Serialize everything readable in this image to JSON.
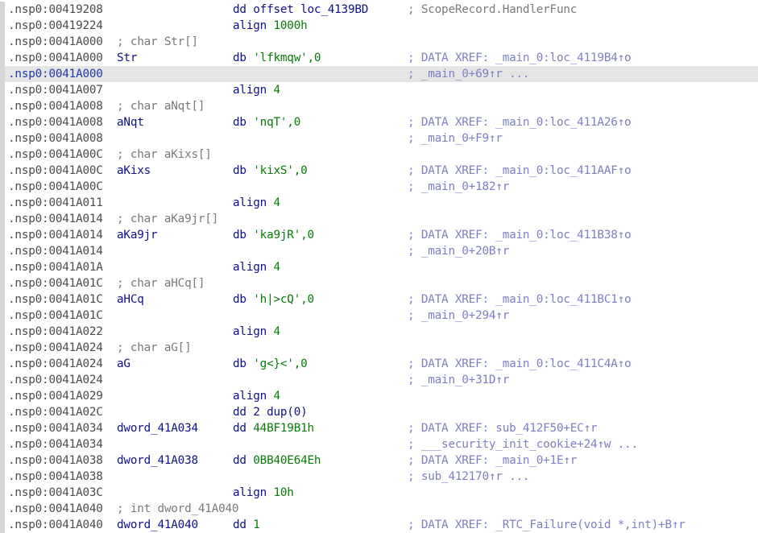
{
  "listing": {
    "lines": [
      {
        "addr": ".nsp0:00419208",
        "label": "",
        "mnemonic": "dd",
        "operand": "offset loc_4139BD",
        "operand_kind": "plain",
        "comment": "; ScopeRecord.HandlerFunc",
        "comment_kind": "gray",
        "header": ""
      },
      {
        "addr": ".nsp0:00419224",
        "label": "",
        "mnemonic": "align",
        "operand": "1000h",
        "operand_kind": "num",
        "comment": "",
        "comment_kind": "",
        "header": ""
      },
      {
        "addr": ".nsp0:0041A000",
        "label": "",
        "mnemonic": "",
        "operand": "",
        "operand_kind": "",
        "comment": "",
        "comment_kind": "",
        "header": "; char Str[]"
      },
      {
        "addr": ".nsp0:0041A000",
        "label": "Str",
        "mnemonic": "db",
        "operand": "'lfkmqw',0",
        "operand_kind": "str",
        "comment": "; DATA XREF: _main_0:loc_4119B4↑o",
        "comment_kind": "xref",
        "header": ""
      },
      {
        "addr": ".nsp0:0041A000",
        "label": "",
        "mnemonic": "",
        "operand": "",
        "operand_kind": "",
        "comment": "; _main_0+69↑r ...",
        "comment_kind": "xref",
        "header": "",
        "selected": true
      },
      {
        "addr": ".nsp0:0041A007",
        "label": "",
        "mnemonic": "align",
        "operand": "4",
        "operand_kind": "num",
        "comment": "",
        "comment_kind": "",
        "header": ""
      },
      {
        "addr": ".nsp0:0041A008",
        "label": "",
        "mnemonic": "",
        "operand": "",
        "operand_kind": "",
        "comment": "",
        "comment_kind": "",
        "header": "; char aNqt[]"
      },
      {
        "addr": ".nsp0:0041A008",
        "label": "aNqt",
        "mnemonic": "db",
        "operand": "'nqT',0",
        "operand_kind": "str",
        "comment": "; DATA XREF: _main_0:loc_411A26↑o",
        "comment_kind": "xref",
        "header": ""
      },
      {
        "addr": ".nsp0:0041A008",
        "label": "",
        "mnemonic": "",
        "operand": "",
        "operand_kind": "",
        "comment": "; _main_0+F9↑r",
        "comment_kind": "xref",
        "header": ""
      },
      {
        "addr": ".nsp0:0041A00C",
        "label": "",
        "mnemonic": "",
        "operand": "",
        "operand_kind": "",
        "comment": "",
        "comment_kind": "",
        "header": "; char aKixs[]"
      },
      {
        "addr": ".nsp0:0041A00C",
        "label": "aKixs",
        "mnemonic": "db",
        "operand": "'kixS',0",
        "operand_kind": "str",
        "comment": "; DATA XREF: _main_0:loc_411AAF↑o",
        "comment_kind": "xref",
        "header": ""
      },
      {
        "addr": ".nsp0:0041A00C",
        "label": "",
        "mnemonic": "",
        "operand": "",
        "operand_kind": "",
        "comment": "; _main_0+182↑r",
        "comment_kind": "xref",
        "header": ""
      },
      {
        "addr": ".nsp0:0041A011",
        "label": "",
        "mnemonic": "align",
        "operand": "4",
        "operand_kind": "num",
        "comment": "",
        "comment_kind": "",
        "header": ""
      },
      {
        "addr": ".nsp0:0041A014",
        "label": "",
        "mnemonic": "",
        "operand": "",
        "operand_kind": "",
        "comment": "",
        "comment_kind": "",
        "header": "; char aKa9jr[]"
      },
      {
        "addr": ".nsp0:0041A014",
        "label": "aKa9jr",
        "mnemonic": "db",
        "operand": "'ka9jR',0",
        "operand_kind": "str",
        "comment": "; DATA XREF: _main_0:loc_411B38↑o",
        "comment_kind": "xref",
        "header": ""
      },
      {
        "addr": ".nsp0:0041A014",
        "label": "",
        "mnemonic": "",
        "operand": "",
        "operand_kind": "",
        "comment": "; _main_0+20B↑r",
        "comment_kind": "xref",
        "header": ""
      },
      {
        "addr": ".nsp0:0041A01A",
        "label": "",
        "mnemonic": "align",
        "operand": "4",
        "operand_kind": "num",
        "comment": "",
        "comment_kind": "",
        "header": ""
      },
      {
        "addr": ".nsp0:0041A01C",
        "label": "",
        "mnemonic": "",
        "operand": "",
        "operand_kind": "",
        "comment": "",
        "comment_kind": "",
        "header": "; char aHCq[]"
      },
      {
        "addr": ".nsp0:0041A01C",
        "label": "aHCq",
        "mnemonic": "db",
        "operand": "'h|>cQ',0",
        "operand_kind": "str",
        "comment": "; DATA XREF: _main_0:loc_411BC1↑o",
        "comment_kind": "xref",
        "header": ""
      },
      {
        "addr": ".nsp0:0041A01C",
        "label": "",
        "mnemonic": "",
        "operand": "",
        "operand_kind": "",
        "comment": "; _main_0+294↑r",
        "comment_kind": "xref",
        "header": ""
      },
      {
        "addr": ".nsp0:0041A022",
        "label": "",
        "mnemonic": "align",
        "operand": "4",
        "operand_kind": "num",
        "comment": "",
        "comment_kind": "",
        "header": ""
      },
      {
        "addr": ".nsp0:0041A024",
        "label": "",
        "mnemonic": "",
        "operand": "",
        "operand_kind": "",
        "comment": "",
        "comment_kind": "",
        "header": "; char aG[]"
      },
      {
        "addr": ".nsp0:0041A024",
        "label": "aG",
        "mnemonic": "db",
        "operand": "'g<}<',0",
        "operand_kind": "str",
        "comment": "; DATA XREF: _main_0:loc_411C4A↑o",
        "comment_kind": "xref",
        "header": ""
      },
      {
        "addr": ".nsp0:0041A024",
        "label": "",
        "mnemonic": "",
        "operand": "",
        "operand_kind": "",
        "comment": "; _main_0+31D↑r",
        "comment_kind": "xref",
        "header": ""
      },
      {
        "addr": ".nsp0:0041A029",
        "label": "",
        "mnemonic": "align",
        "operand": "4",
        "operand_kind": "num",
        "comment": "",
        "comment_kind": "",
        "header": ""
      },
      {
        "addr": ".nsp0:0041A02C",
        "label": "",
        "mnemonic": "dd",
        "operand": "2 dup(0)",
        "operand_kind": "plain",
        "comment": "",
        "comment_kind": "",
        "header": ""
      },
      {
        "addr": ".nsp0:0041A034",
        "label": "dword_41A034",
        "mnemonic": "dd",
        "operand": "44BF19B1h",
        "operand_kind": "num",
        "comment": "; DATA XREF: sub_412F50+EC↑r",
        "comment_kind": "xref",
        "header": ""
      },
      {
        "addr": ".nsp0:0041A034",
        "label": "",
        "mnemonic": "",
        "operand": "",
        "operand_kind": "",
        "comment": "; ___security_init_cookie+24↑w ...",
        "comment_kind": "xref",
        "header": ""
      },
      {
        "addr": ".nsp0:0041A038",
        "label": "dword_41A038",
        "mnemonic": "dd",
        "operand": "0BB40E64Eh",
        "operand_kind": "num",
        "comment": "; DATA XREF: _main_0+1E↑r",
        "comment_kind": "xref",
        "header": ""
      },
      {
        "addr": ".nsp0:0041A038",
        "label": "",
        "mnemonic": "",
        "operand": "",
        "operand_kind": "",
        "comment": "; sub_412170↑r ...",
        "comment_kind": "xref",
        "header": ""
      },
      {
        "addr": ".nsp0:0041A03C",
        "label": "",
        "mnemonic": "align",
        "operand": "10h",
        "operand_kind": "num",
        "comment": "",
        "comment_kind": "",
        "header": ""
      },
      {
        "addr": ".nsp0:0041A040",
        "label": "",
        "mnemonic": "",
        "operand": "",
        "operand_kind": "",
        "comment": "",
        "comment_kind": "",
        "header": "; int dword_41A040"
      },
      {
        "addr": ".nsp0:0041A040",
        "label": "dword_41A040",
        "mnemonic": "dd",
        "operand": "1",
        "operand_kind": "num",
        "comment": "; DATA XREF: _RTC_Failure(void *,int)+B↑r",
        "comment_kind": "xref",
        "header": ""
      }
    ]
  }
}
